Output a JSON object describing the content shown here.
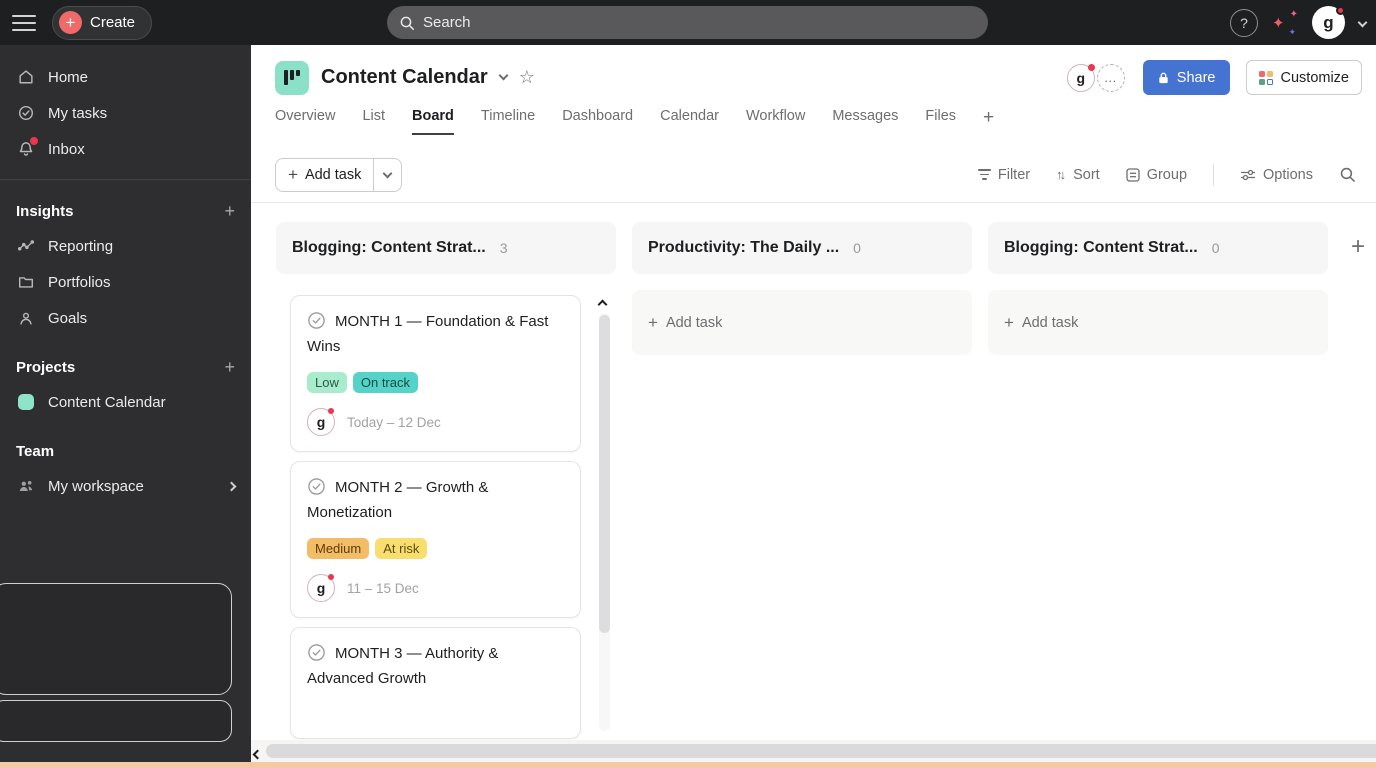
{
  "topbar": {
    "create_label": "Create",
    "search_placeholder": "Search",
    "help_label": "?",
    "avatar_initial": "g"
  },
  "sidebar": {
    "home_label": "Home",
    "my_tasks_label": "My tasks",
    "inbox_label": "Inbox",
    "insights_title": "Insights",
    "reporting_label": "Reporting",
    "portfolios_label": "Portfolios",
    "goals_label": "Goals",
    "projects_title": "Projects",
    "project_content_calendar_label": "Content Calendar",
    "team_title": "Team",
    "my_workspace_label": "My workspace"
  },
  "header": {
    "project_title": "Content Calendar",
    "more_label": "…",
    "share_label": "Share",
    "customize_label": "Customize",
    "avatar_initial": "g",
    "star_glyph": "☆"
  },
  "tabs": [
    "Overview",
    "List",
    "Board",
    "Timeline",
    "Dashboard",
    "Calendar",
    "Workflow",
    "Messages",
    "Files"
  ],
  "active_tab": "Board",
  "toolbar": {
    "add_task_label": "Add task",
    "filter_label": "Filter",
    "sort_label": "Sort",
    "group_label": "Group",
    "options_label": "Options",
    "sort_icon_glyph": "↑↓"
  },
  "board": {
    "columns": [
      {
        "title": "Blogging: Content Strat...",
        "count": "3",
        "cards": [
          {
            "title": "MONTH 1 — Foundation & Fast Wins",
            "badges": [
              {
                "label": "Low"
              },
              {
                "label": "On track"
              }
            ],
            "date": "Today – 12 Dec",
            "avatar_initial": "g"
          },
          {
            "title": "MONTH 2 — Growth & Monetization",
            "badges": [
              {
                "label": "Medium"
              },
              {
                "label": "At risk"
              }
            ],
            "date": "11 – 15 Dec",
            "avatar_initial": "g"
          },
          {
            "title": "MONTH 3 — Authority & Advanced Growth",
            "badges": [],
            "date": ""
          }
        ]
      },
      {
        "title": "Productivity: The Daily ...",
        "count": "0",
        "add_task_label": "Add task"
      },
      {
        "title": "Blogging: Content Strat...",
        "count": "0",
        "add_task_label": "Add task"
      }
    ]
  },
  "colors": {
    "topbar_bg": "#1e1f21",
    "sidebar_bg": "#2e2e30",
    "accent_blue": "#4573d2",
    "create_accent": "#f06a6a",
    "project_icon_mint": "#8be0c8",
    "badge_low_bg": "#a9eccd",
    "badge_on_track_bg": "#55d3c8",
    "badge_medium_bg": "#f2bd66",
    "badge_at_risk_bg": "#f8de6e",
    "notification_red": "#e8384f",
    "bottom_strip_peach": "#f4c9a5"
  }
}
